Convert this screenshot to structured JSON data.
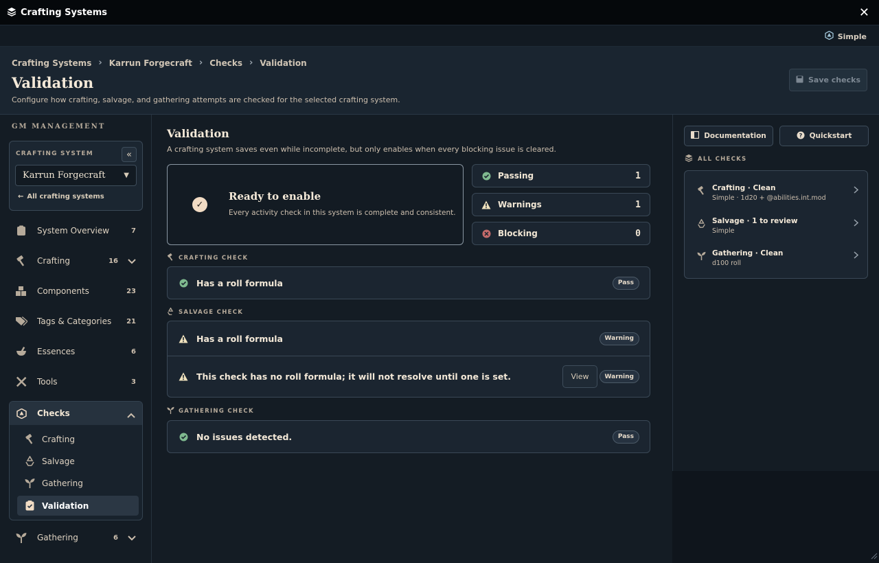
{
  "app": {
    "title": "Crafting Systems",
    "mode": "Simple"
  },
  "breadcrumb": [
    "Crafting Systems",
    "Karrun Forgecraft",
    "Checks",
    "Validation"
  ],
  "header": {
    "title": "Validation",
    "subtitle": "Configure how crafting, salvage, and gathering attempts are checked for the selected crafting system.",
    "save_label": "Save checks"
  },
  "sidebar": {
    "section_label": "GM MANAGEMENT",
    "system_label": "CRAFTING SYSTEM",
    "system_value": "Karrun Forgecraft",
    "back_label": "All crafting systems",
    "items": [
      {
        "label": "System Overview",
        "count": "7"
      },
      {
        "label": "Crafting",
        "count": "16"
      },
      {
        "label": "Components",
        "count": "23"
      },
      {
        "label": "Tags & Categories",
        "count": "21"
      },
      {
        "label": "Essences",
        "count": "6"
      },
      {
        "label": "Tools",
        "count": "3"
      }
    ],
    "checks": {
      "label": "Checks",
      "sub": [
        "Crafting",
        "Salvage",
        "Gathering",
        "Validation"
      ]
    },
    "gathering": {
      "label": "Gathering",
      "count": "6"
    }
  },
  "main": {
    "title": "Validation",
    "description": "A crafting system saves even while incomplete, but only enables when every blocking issue is cleared.",
    "ready_title": "Ready to enable",
    "ready_sub": "Every activity check in this system is complete and consistent.",
    "stats": [
      {
        "label": "Passing",
        "value": "1"
      },
      {
        "label": "Warnings",
        "value": "1"
      },
      {
        "label": "Blocking",
        "value": "0"
      }
    ],
    "crafting": {
      "label": "CRAFTING CHECK",
      "row": "Has a roll formula",
      "badge": "Pass"
    },
    "salvage": {
      "label": "SALVAGE CHECK",
      "row1": "Has a roll formula",
      "badge1": "Warning",
      "row2": "This check has no roll formula; it will not resolve until one is set.",
      "view": "View",
      "badge2": "Warning"
    },
    "gathering": {
      "label": "GATHERING CHECK",
      "row": "No issues detected.",
      "badge": "Pass"
    }
  },
  "right": {
    "docs": "Documentation",
    "quickstart": "Quickstart",
    "all_label": "ALL CHECKS",
    "items": [
      {
        "title": "Crafting · Clean",
        "sub": "Simple · 1d20 + @abilities.int.mod"
      },
      {
        "title": "Salvage · 1 to review",
        "sub": "Simple"
      },
      {
        "title": "Gathering · Clean",
        "sub": "d100 roll"
      }
    ]
  },
  "colors": {
    "pass": "#7fb98f",
    "warning": "#f0e2bd",
    "blocking": "#c46a6a",
    "accent": "#f2dcc4"
  }
}
